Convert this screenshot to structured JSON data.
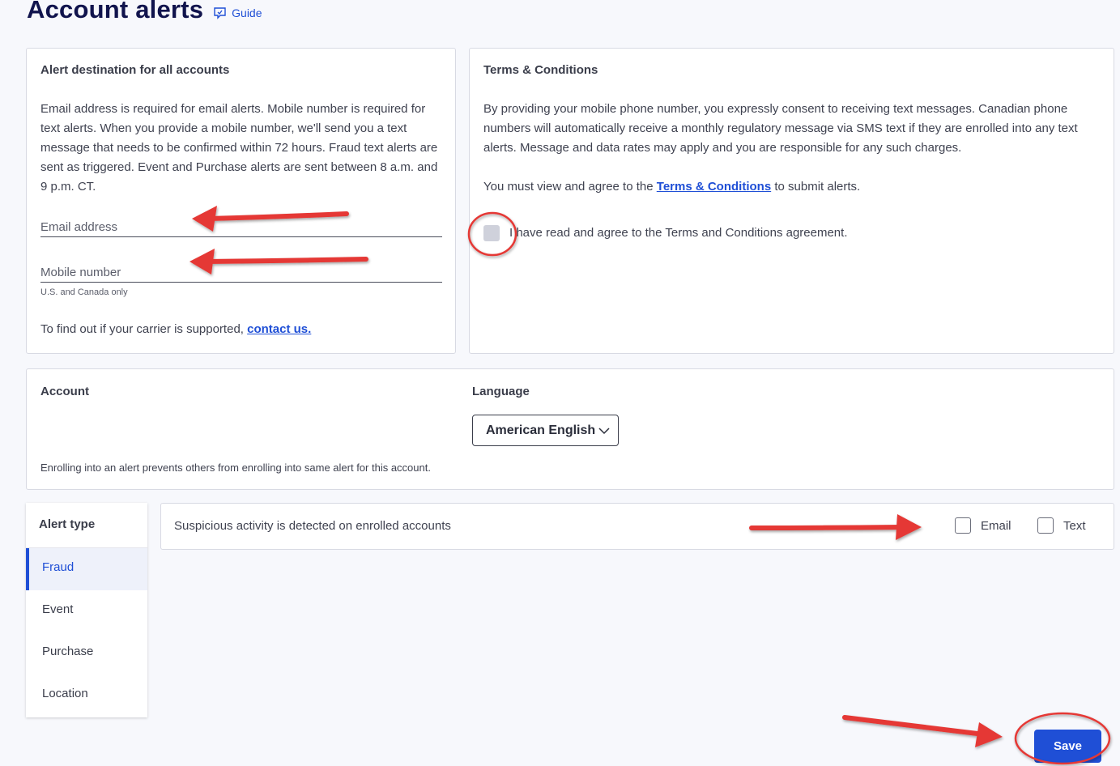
{
  "header": {
    "title": "Account alerts",
    "guide_label": "Guide",
    "guide_icon": "chat-guide-icon"
  },
  "destination": {
    "title": "Alert destination for all accounts",
    "description": "Email address is required for email alerts. Mobile number is required for text alerts. When you provide a mobile number, we'll send you a text message that needs to be confirmed within 72 hours. Fraud text alerts are sent as triggered. Event and Purchase alerts are sent between 8 a.m. and 9 p.m. CT.",
    "email_placeholder": "Email address",
    "email_value": "",
    "mobile_placeholder": "Mobile number",
    "mobile_value": "",
    "mobile_hint": "U.S. and Canada only",
    "carrier_text": "To find out if your carrier is supported,",
    "contact_link": "contact us."
  },
  "terms": {
    "title": "Terms & Conditions",
    "description": "By providing your mobile phone number, you expressly consent to receiving text messages. Canadian phone numbers will automatically receive a monthly regulatory message via SMS text if they are enrolled into any text alerts. Message and data rates may apply and you are responsible for any such charges.",
    "must_view_prefix": "You must view and agree to the",
    "terms_link": "Terms & Conditions",
    "must_view_suffix": "to submit alerts.",
    "agree_label": "I have read and agree to the Terms and Conditions agreement.",
    "agree_checked": false
  },
  "account": {
    "account_label": "Account",
    "language_label": "Language",
    "language_selected": "American English",
    "note": "Enrolling into an alert prevents others from enrolling into same alert for this account."
  },
  "alert_types": {
    "header": "Alert type",
    "items": [
      {
        "label": "Fraud",
        "active": true
      },
      {
        "label": "Event",
        "active": false
      },
      {
        "label": "Purchase",
        "active": false
      },
      {
        "label": "Location",
        "active": false
      }
    ]
  },
  "alert_row": {
    "description": "Suspicious activity is detected on enrolled accounts",
    "email_label": "Email",
    "email_checked": false,
    "text_label": "Text",
    "text_checked": false
  },
  "actions": {
    "save_label": "Save"
  },
  "colors": {
    "primary": "#1f4fd6",
    "title": "#11144d",
    "annotation": "#e53935"
  }
}
